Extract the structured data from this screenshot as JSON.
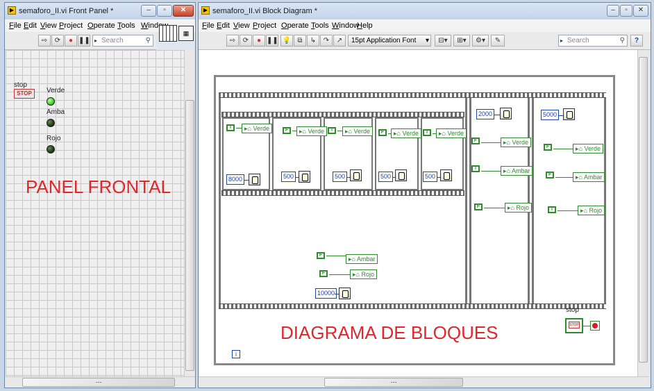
{
  "front_panel": {
    "title": "semaforo_II.vi Front Panel *",
    "menu": [
      "File",
      "Edit",
      "View",
      "Project",
      "Operate",
      "Tools",
      "Window"
    ],
    "search_placeholder": "Search",
    "stop_label": "stop",
    "stop_button": "STOP",
    "leds": [
      {
        "label": "Verde",
        "color": "#3fd22e"
      },
      {
        "label": "Amba",
        "color": "#1f3a14"
      },
      {
        "label": "Rojo",
        "color": "#1f3a14"
      }
    ],
    "annotation": "PANEL FRONTAL",
    "scroll_dots": "⋯"
  },
  "block_diagram": {
    "title": "semaforo_II.vi Block Diagram *",
    "menu": [
      "File",
      "Edit",
      "View",
      "Project",
      "Operate",
      "Tools",
      "Window",
      "Help"
    ],
    "font_selector": "15pt Application Font",
    "search_placeholder": "Search",
    "frame0": {
      "subframes": [
        {
          "local": "Verde",
          "bool": "T",
          "ms": "8000"
        },
        {
          "local": "Verde",
          "bool": "F",
          "ms": "500"
        },
        {
          "local": "Verde",
          "bool": "T",
          "ms": "500"
        },
        {
          "local": "Verde",
          "bool": "F",
          "ms": "500"
        },
        {
          "local": "Verde",
          "bool": "T",
          "ms": "500"
        }
      ],
      "bottom": [
        {
          "bool": "F",
          "local": "Ambar"
        },
        {
          "bool": "F",
          "local": "Rojo"
        }
      ],
      "bottom_ms": "10000"
    },
    "frame1": {
      "ms": "2000",
      "items": [
        {
          "bool": "F",
          "local": "Verde"
        },
        {
          "bool": "T",
          "local": "Ambar"
        },
        {
          "bool": "F",
          "local": "Rojo"
        }
      ]
    },
    "frame2": {
      "ms": "5000",
      "items": [
        {
          "bool": "F",
          "local": "Verde"
        },
        {
          "bool": "F",
          "local": "Ambar"
        },
        {
          "bool": "T",
          "local": "Rojo"
        }
      ]
    },
    "annotation": "DIAGRAMA DE BLOQUES",
    "stop_label": "stop",
    "stop_terminal": "STOP",
    "iteration": "i",
    "scroll_dots": "⋯"
  },
  "colors": {
    "annotation": "#e2262a",
    "bool_wire": "#2e8b2e",
    "numeric_wire": "#1a44a8",
    "led_on": "#3fd22e",
    "led_off": "#1f3a14"
  }
}
